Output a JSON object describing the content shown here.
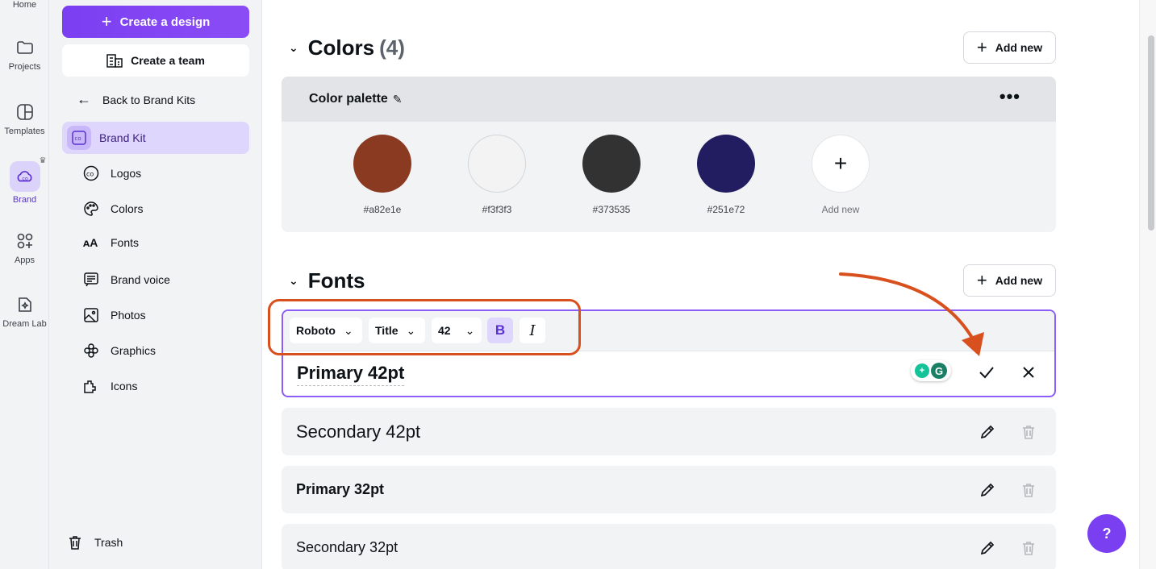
{
  "rail": {
    "items": [
      {
        "label": "Home",
        "icon": "home-icon"
      },
      {
        "label": "Projects",
        "icon": "folder-icon"
      },
      {
        "label": "Templates",
        "icon": "templates-icon"
      },
      {
        "label": "Brand",
        "icon": "brand-icon"
      },
      {
        "label": "Apps",
        "icon": "apps-icon"
      },
      {
        "label": "Dream Lab",
        "icon": "dream-lab-icon"
      }
    ]
  },
  "sidebar": {
    "create_design": "Create a design",
    "create_team": "Create a team",
    "back": "Back to Brand Kits",
    "brand_kit": "Brand Kit",
    "items": [
      {
        "label": "Logos",
        "icon": "logo-icon"
      },
      {
        "label": "Colors",
        "icon": "palette-icon"
      },
      {
        "label": "Fonts",
        "icon": "fonts-icon"
      },
      {
        "label": "Brand voice",
        "icon": "brand-voice-icon"
      },
      {
        "label": "Photos",
        "icon": "photo-icon"
      },
      {
        "label": "Graphics",
        "icon": "graphics-icon"
      },
      {
        "label": "Icons",
        "icon": "icons-icon"
      }
    ],
    "trash": "Trash"
  },
  "colors": {
    "title": "Colors",
    "count": "(4)",
    "add_new": "Add new",
    "palette_name": "Color palette",
    "swatches": [
      {
        "hex": "#a82e1e",
        "label": "#a82e1e",
        "display": "#8b3a22"
      },
      {
        "hex": "#f3f3f3",
        "label": "#f3f3f3",
        "display": "#f3f3f3"
      },
      {
        "hex": "#373535",
        "label": "#373535",
        "display": "#323232"
      },
      {
        "hex": "#251e72",
        "label": "#251e72",
        "display": "#221d60"
      }
    ],
    "add_swatch_label": "Add new"
  },
  "fonts": {
    "title": "Fonts",
    "add_new": "Add new",
    "editor": {
      "font_family": "Roboto",
      "style": "Title",
      "size": "42",
      "bold_label": "B",
      "italic_label": "I",
      "text": "Primary 42pt"
    },
    "rows": [
      {
        "label": "Secondary 42pt"
      },
      {
        "label": "Primary 32pt"
      },
      {
        "label": "Secondary 32pt"
      }
    ]
  },
  "help_label": "?",
  "accent": "#7b3ff2",
  "annotation_color": "#d9501f"
}
